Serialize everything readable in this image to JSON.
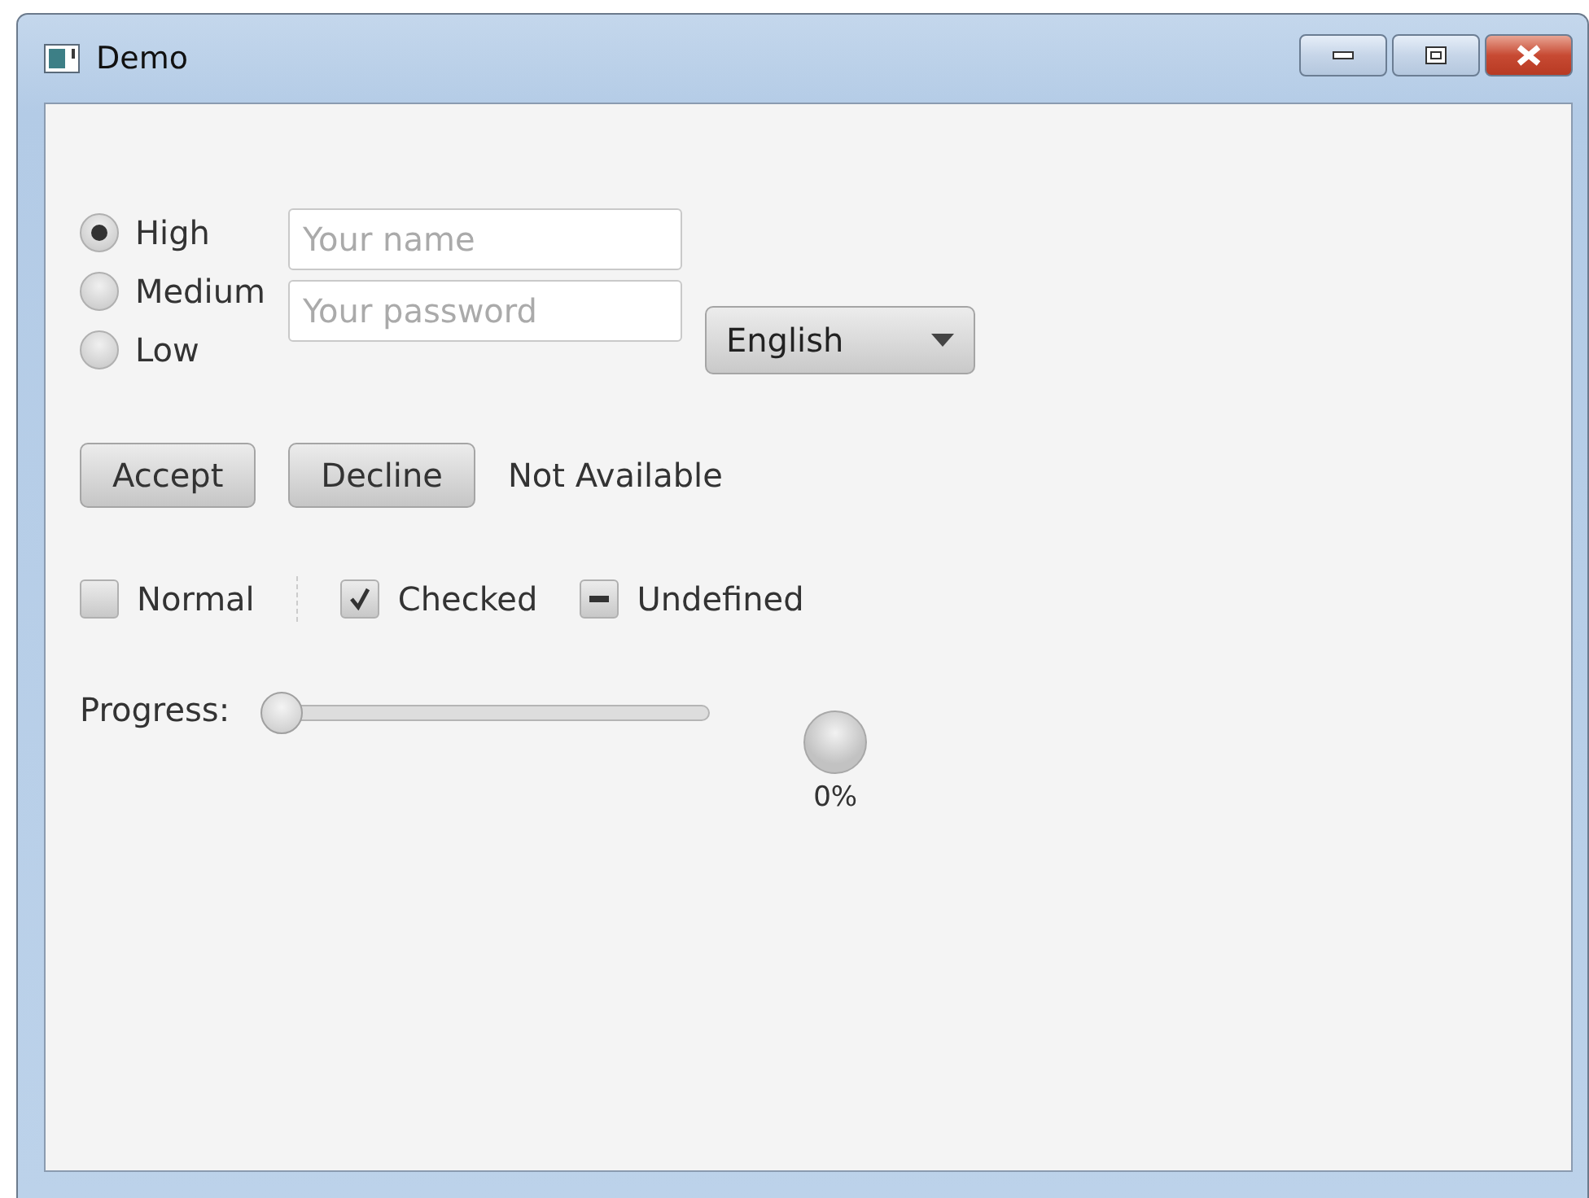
{
  "window": {
    "title": "Demo"
  },
  "priority": [
    {
      "label": "High",
      "selected": true
    },
    {
      "label": "Medium",
      "selected": false
    },
    {
      "label": "Low",
      "selected": false
    }
  ],
  "fields": [
    {
      "placeholder": "Your name"
    },
    {
      "placeholder": "Your password"
    }
  ],
  "language": {
    "value": "English"
  },
  "buttons": [
    "Accept",
    "Decline"
  ],
  "status": "Not Available",
  "checkboxes": [
    {
      "label": "Normal",
      "checked": false,
      "indeterminate": false
    },
    {
      "label": "Checked",
      "checked": true,
      "indeterminate": false
    },
    {
      "label": "Undefined",
      "checked": false,
      "indeterminate": true
    }
  ],
  "progress": {
    "label": "Progress:",
    "slider": {
      "level": 0
    },
    "indicator": {
      "reading": "0%"
    }
  }
}
